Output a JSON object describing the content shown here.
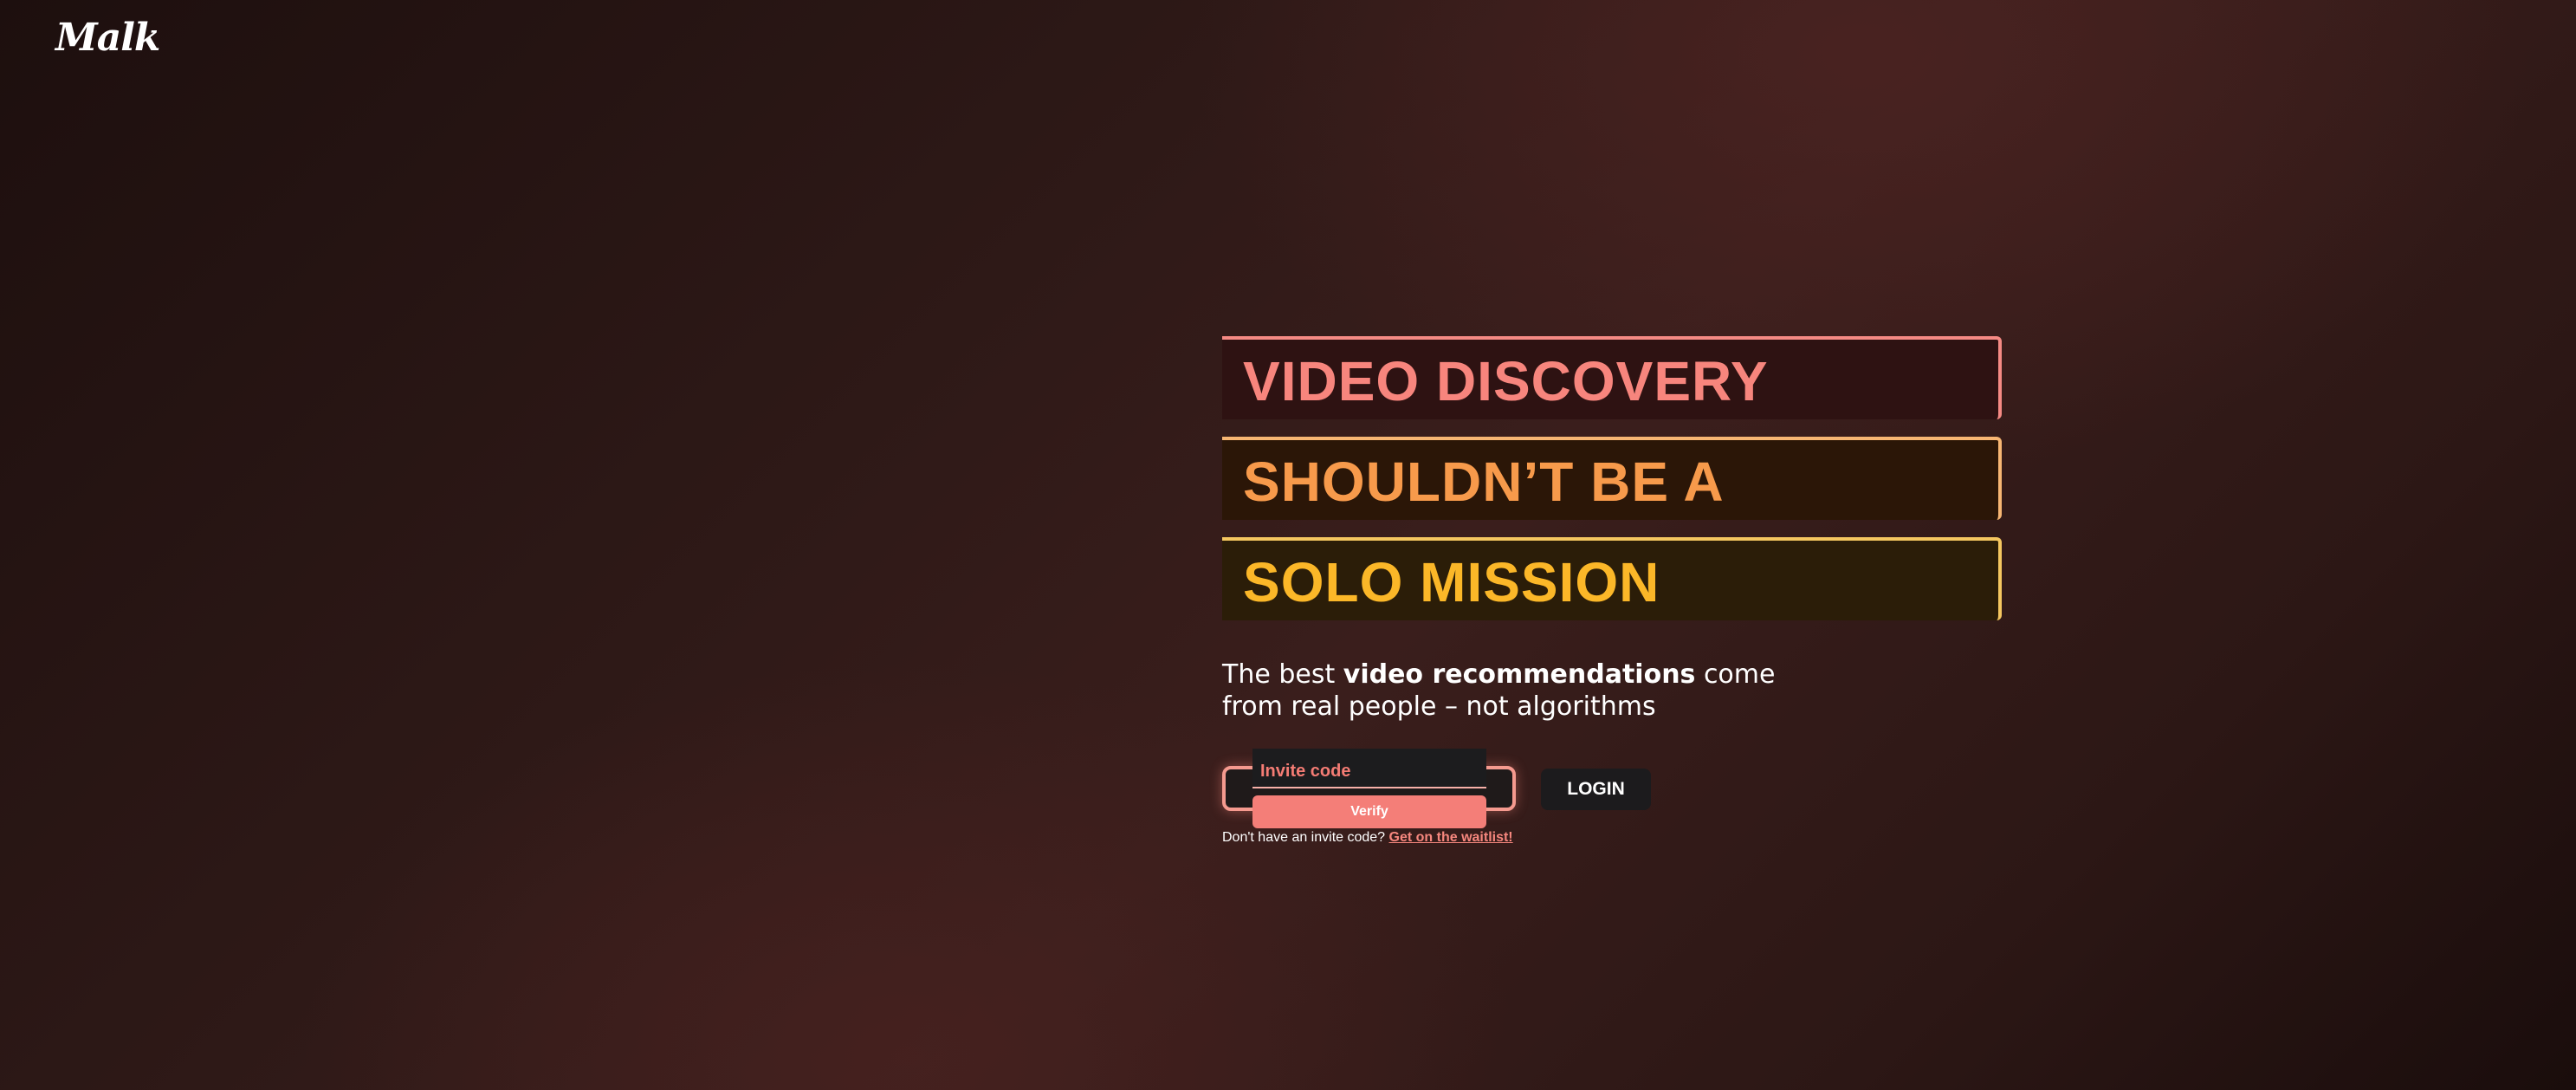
{
  "brand": {
    "logo_text": "Malk"
  },
  "headline": {
    "lines": [
      "VIDEO DISCOVERY",
      "SHOULDN’T BE A",
      "SOLO MISSION"
    ],
    "colors": [
      "#f7857d",
      "#f79a4b",
      "#fbb728"
    ]
  },
  "tagline": {
    "part1": "The best ",
    "bold": "video recommendations",
    "part2": " come",
    "line2": "from real people – not algorithms"
  },
  "invite": {
    "placeholder": "Invite code",
    "verify_label": "Verify"
  },
  "login": {
    "label": "LOGIN"
  },
  "waitlist": {
    "prompt": "Don't have an invite code? ",
    "link_label": "Get on the waitlist!"
  }
}
